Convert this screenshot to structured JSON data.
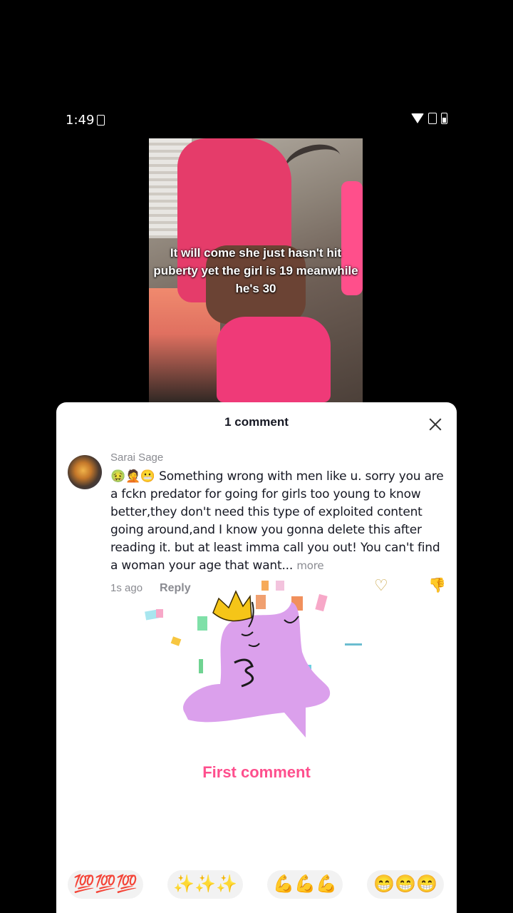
{
  "status_bar": {
    "time": "1:49"
  },
  "video": {
    "caption": "It will come she just hasn't hit puberty yet the girl is 19 meanwhile he's 30"
  },
  "comments_sheet": {
    "title": "1 comment",
    "comment": {
      "author": "Sarai Sage",
      "text": "🤢🤦😬 Something wrong with men like u. sorry you are a fckn predator for going for girls too young to know better,they don't need this type of exploited content going around,and I know you gonna delete this after reading it. but at least imma call you out! You can't find a woman your age that want...",
      "more_label": "more",
      "timestamp": "1s ago",
      "reply_label": "Reply"
    },
    "first_comment_label": "First comment",
    "quick_emojis": [
      "💯💯💯",
      "✨✨✨",
      "💪💪💪",
      "😁😁😁"
    ]
  },
  "colors": {
    "accent": "#fe4f8d",
    "sheet_bg": "#ffffff",
    "page_bg": "#000000"
  }
}
